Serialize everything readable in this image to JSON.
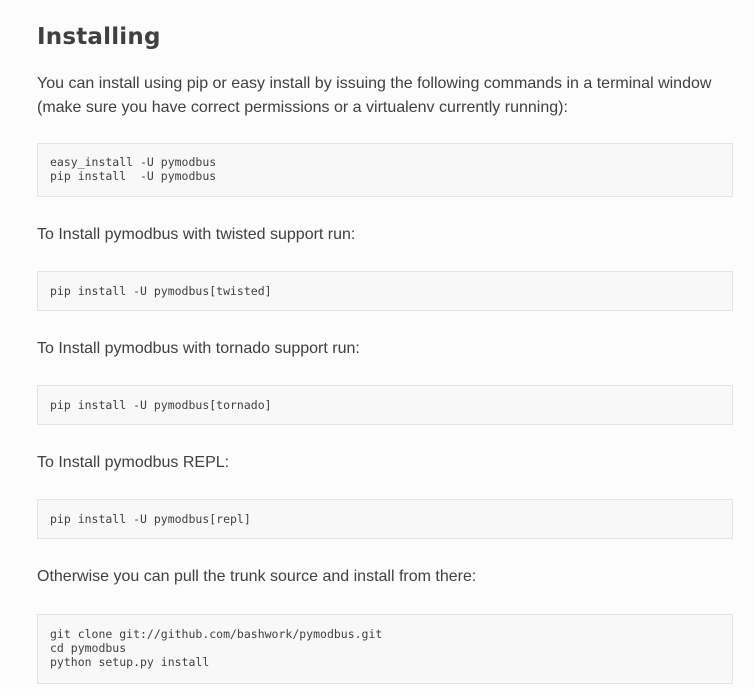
{
  "section": {
    "title": "Installing",
    "intro": "You can install using pip or easy install by issuing the following commands in a terminal window (make sure you have correct permissions or a virtualenv currently running):",
    "code_basic": "easy_install -U pymodbus\npip install  -U pymodbus",
    "twisted_text": "To Install pymodbus with twisted support run:",
    "code_twisted": "pip install -U pymodbus[twisted]",
    "tornado_text": "To Install pymodbus with tornado support run:",
    "code_tornado": "pip install -U pymodbus[tornado]",
    "repl_text": "To Install pymodbus REPL:",
    "code_repl": "pip install -U pymodbus[repl]",
    "source_text": "Otherwise you can pull the trunk source and install from there:",
    "code_source": "git clone git://github.com/bashwork/pymodbus.git\ncd pymodbus\npython setup.py install"
  }
}
